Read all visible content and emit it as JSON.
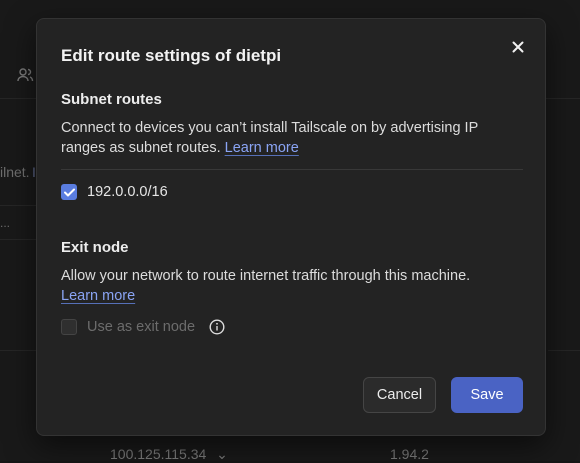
{
  "background": {
    "partial_text_1": "ilnet.",
    "partial_text_2": "...",
    "ip_address": "100.125.115.34",
    "version": "1.94.2"
  },
  "dialog": {
    "title": "Edit route settings of dietpi",
    "subnet": {
      "heading": "Subnet routes",
      "description": "Connect to devices you can’t install Tailscale on by advertising IP ranges as subnet routes.",
      "link": "Learn more",
      "routes": [
        {
          "label": "192.0.0.0/16",
          "checked": true
        }
      ]
    },
    "exit_node": {
      "heading": "Exit node",
      "description": "Allow your network to route internet traffic through this machine.",
      "link": "Learn more",
      "option_label": "Use as exit node",
      "checked": false,
      "disabled": true
    },
    "buttons": {
      "cancel": "Cancel",
      "save": "Save"
    }
  },
  "colors": {
    "accent": "#4a63c4",
    "link": "#8aa4f4",
    "checkbox": "#5a7de0"
  }
}
